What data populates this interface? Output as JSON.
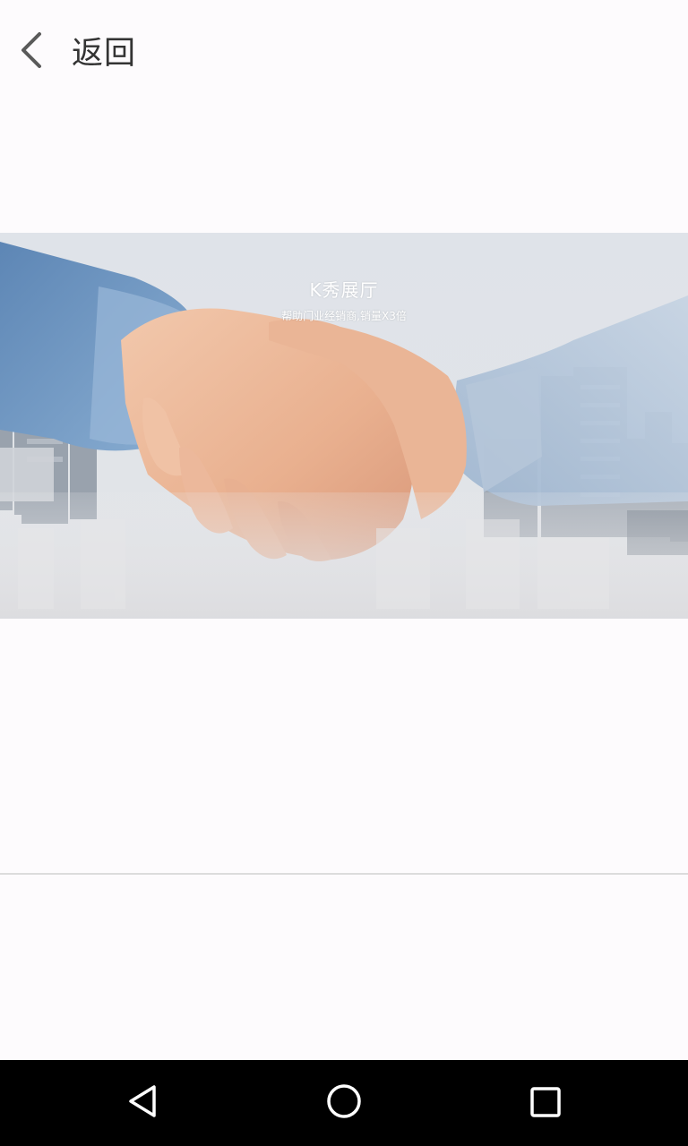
{
  "header": {
    "back_label": "返回",
    "back_icon": "chevron-left-icon"
  },
  "banner": {
    "title": "K秀展厅",
    "subtitle": "帮助门业经销商,销量X3倍",
    "image_subject": "handshake over city skyline"
  },
  "navbar": {
    "back_icon": "triangle-back-icon",
    "home_icon": "circle-home-icon",
    "recents_icon": "square-recents-icon"
  },
  "colors": {
    "background": "#fdfbfd",
    "divider": "#dcdcdc",
    "navbar": "#000000",
    "text": "#333333"
  }
}
